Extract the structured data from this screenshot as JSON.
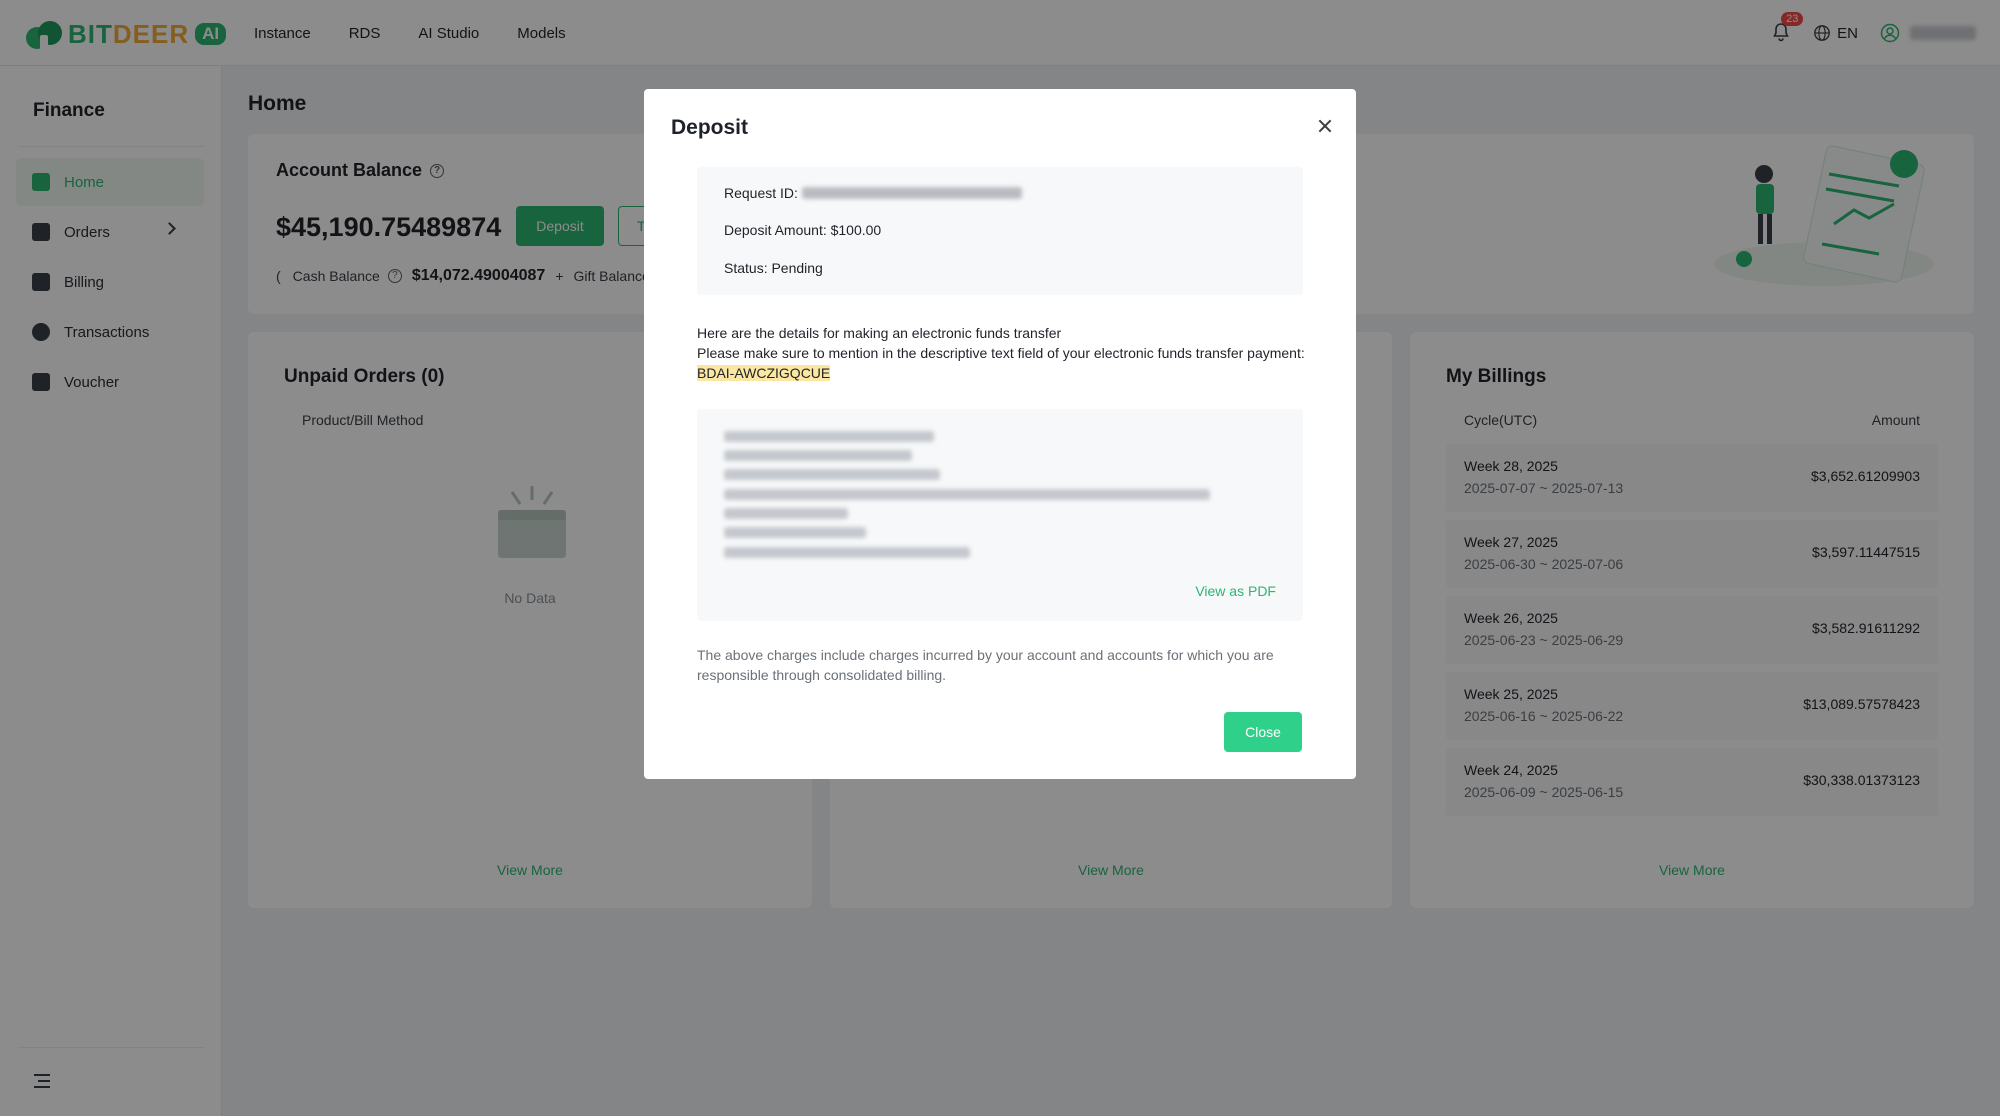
{
  "brand": {
    "name_part1": "BIT",
    "name_part2": "DEER",
    "badge": "AI"
  },
  "nav": {
    "items": [
      "Instance",
      "RDS",
      "AI Studio",
      "Models"
    ]
  },
  "header": {
    "notification_count": "23",
    "language": "EN"
  },
  "sidebar": {
    "title": "Finance",
    "items": [
      {
        "label": "Home"
      },
      {
        "label": "Orders"
      },
      {
        "label": "Billing"
      },
      {
        "label": "Transactions"
      },
      {
        "label": "Voucher"
      }
    ]
  },
  "main": {
    "page_title": "Home",
    "balance": {
      "title": "Account Balance",
      "amount": "$45,190.75489874",
      "deposit_label": "Deposit",
      "second_button_partial": "T",
      "open_paren": "(",
      "cash_label": "Cash Balance",
      "cash_value": "$14,072.49004087",
      "plus": "+",
      "gift_label": "Gift Balance"
    },
    "unpaid": {
      "title": "Unpaid Orders (0)",
      "column": "Product/Bill Method",
      "empty": "No Data",
      "view_more": "View More"
    },
    "middle": {
      "view_more": "View More"
    },
    "billings": {
      "title": "My Billings",
      "col_cycle": "Cycle(UTC)",
      "col_amount": "Amount",
      "rows": [
        {
          "week": "Week 28, 2025",
          "range": "2025-07-07 ~ 2025-07-13",
          "amount": "$3,652.61209903"
        },
        {
          "week": "Week 27, 2025",
          "range": "2025-06-30 ~ 2025-07-06",
          "amount": "$3,597.11447515"
        },
        {
          "week": "Week 26, 2025",
          "range": "2025-06-23 ~ 2025-06-29",
          "amount": "$3,582.91611292"
        },
        {
          "week": "Week 25, 2025",
          "range": "2025-06-16 ~ 2025-06-22",
          "amount": "$13,089.57578423"
        },
        {
          "week": "Week 24, 2025",
          "range": "2025-06-09 ~ 2025-06-15",
          "amount": "$30,338.01373123"
        }
      ],
      "view_more": "View More"
    }
  },
  "modal": {
    "title": "Deposit",
    "request_id_label": "Request ID:",
    "deposit_amount": "Deposit Amount: $100.00",
    "status": "Status: Pending",
    "instr_line1": "Here are the details for making an electronic funds transfer",
    "instr_line2": "Please make sure to mention in the descriptive text field of your electronic funds transfer payment:",
    "reference_code": "BDAI-AWCZIGQCUE",
    "view_pdf": "View as PDF",
    "note": "The above charges include charges incurred by your account and accounts for which you are responsible through consolidated billing.",
    "close_label": "Close"
  },
  "colors": {
    "accent": "#2bb673",
    "close_button": "#2fd08a",
    "highlight": "#fbe7a1",
    "badge": "#f04a4a"
  }
}
